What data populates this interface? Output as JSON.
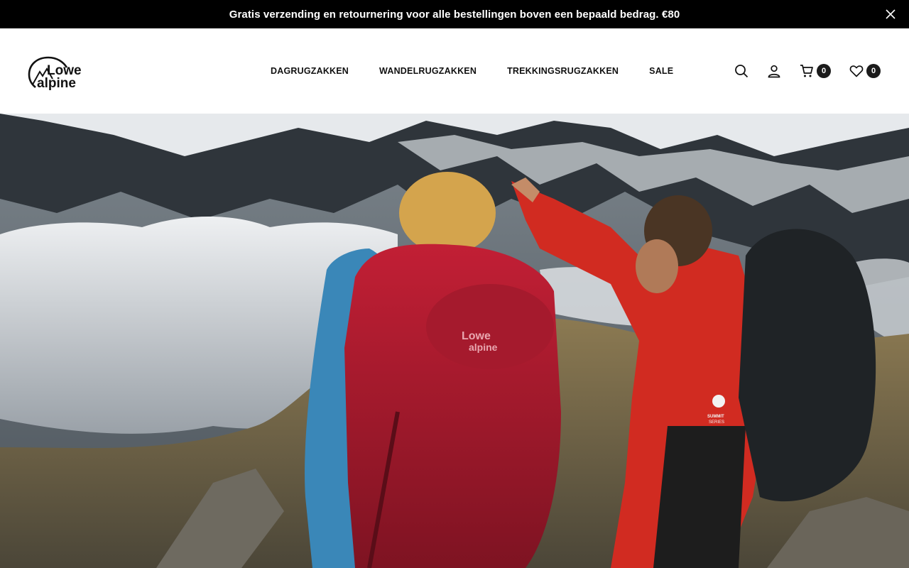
{
  "announcement": {
    "text": "Gratis verzending en retournering voor alle bestellingen boven een bepaald bedrag. €80",
    "close_icon": "close-icon"
  },
  "brand": {
    "logo_line1": "Lowe",
    "logo_line2": "alpine"
  },
  "nav": {
    "items": [
      {
        "label": "DAGRUGZAKKEN"
      },
      {
        "label": "WANDELRUGZAKKEN"
      },
      {
        "label": "TREKKINGSRUGZAKKEN"
      },
      {
        "label": "SALE"
      }
    ]
  },
  "header_icons": {
    "search": "search-icon",
    "account": "user-icon",
    "cart": "cart-icon",
    "cart_count": "0",
    "wishlist": "heart-icon",
    "wishlist_count": "0"
  },
  "hero": {
    "backpack_logo_line1": "Lowe",
    "backpack_logo_line2": "alpine",
    "jacket_badge_line1": "SUMMIT",
    "jacket_badge_line2": "SERIES"
  },
  "colors": {
    "announcement_bg": "#000000",
    "accent_red": "#c8102e",
    "text": "#111111"
  }
}
